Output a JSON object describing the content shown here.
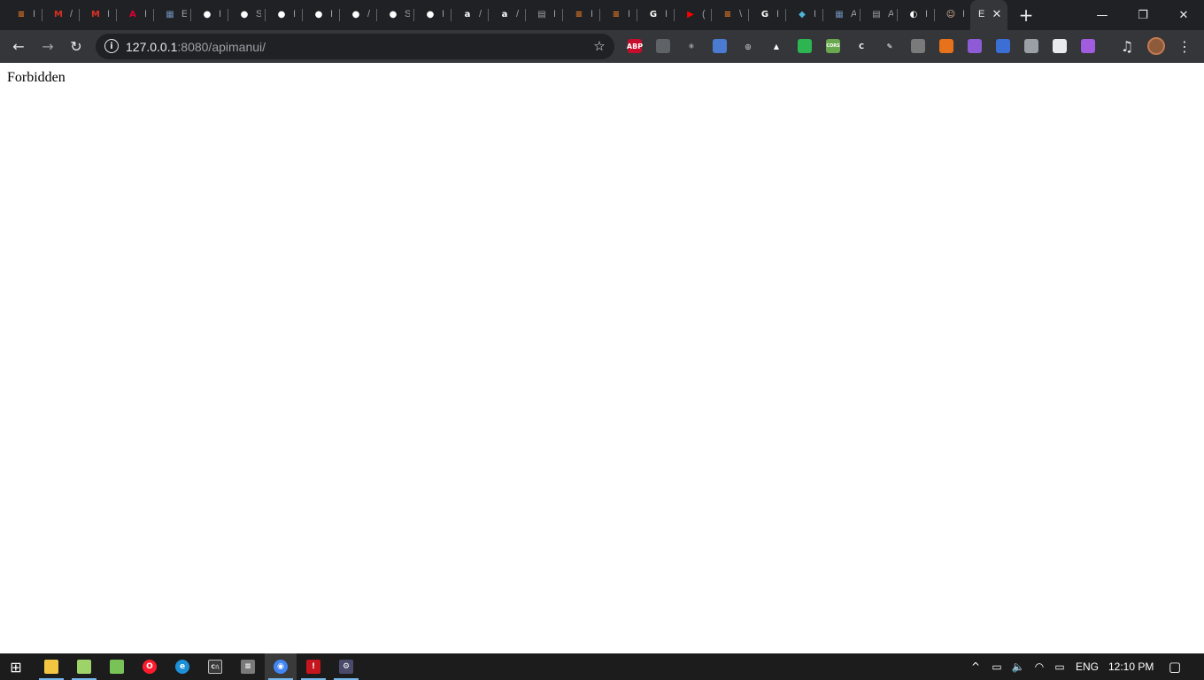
{
  "browser": {
    "tabs": [
      {
        "icon": "stackoverflow-icon",
        "title": "I",
        "color": "#f48024",
        "glyph": "≡"
      },
      {
        "icon": "gmail-icon",
        "title": "/",
        "color": "#d93025",
        "glyph": "M"
      },
      {
        "icon": "gmail-icon",
        "title": "I",
        "color": "#d93025",
        "glyph": "M"
      },
      {
        "icon": "angular-icon",
        "title": "I",
        "color": "#dd0031",
        "glyph": "A"
      },
      {
        "icon": "image-doc-icon",
        "title": "E",
        "color": "#6b8db5",
        "glyph": "▦"
      },
      {
        "icon": "github-icon",
        "title": "I",
        "color": "#ffffff",
        "glyph": "●"
      },
      {
        "icon": "github-icon",
        "title": "S",
        "color": "#ffffff",
        "glyph": "●"
      },
      {
        "icon": "github-icon",
        "title": "I",
        "color": "#ffffff",
        "glyph": "●"
      },
      {
        "icon": "github-icon",
        "title": "I",
        "color": "#ffffff",
        "glyph": "●"
      },
      {
        "icon": "github-icon",
        "title": "/",
        "color": "#ffffff",
        "glyph": "●"
      },
      {
        "icon": "github-icon",
        "title": "S",
        "color": "#ffffff",
        "glyph": "●"
      },
      {
        "icon": "github-icon",
        "title": "I",
        "color": "#ffffff",
        "glyph": "●"
      },
      {
        "icon": "amazon-icon",
        "title": "/",
        "color": "#ffffff",
        "glyph": "a"
      },
      {
        "icon": "amazon-icon",
        "title": "/",
        "color": "#ffffff",
        "glyph": "a"
      },
      {
        "icon": "document-icon",
        "title": "I",
        "color": "#9aa0a6",
        "glyph": "▤"
      },
      {
        "icon": "stackoverflow-icon",
        "title": "I",
        "color": "#f48024",
        "glyph": "≡"
      },
      {
        "icon": "stackoverflow-icon",
        "title": "I",
        "color": "#f48024",
        "glyph": "≡"
      },
      {
        "icon": "google-icon",
        "title": "I",
        "color": "#ffffff",
        "glyph": "G"
      },
      {
        "icon": "youtube-icon",
        "title": "(",
        "color": "#ff0000",
        "glyph": "▶"
      },
      {
        "icon": "stackoverflow-icon",
        "title": "\\",
        "color": "#f48024",
        "glyph": "≡"
      },
      {
        "icon": "google-icon",
        "title": "I",
        "color": "#ffffff",
        "glyph": "G"
      },
      {
        "icon": "cube-icon",
        "title": "I",
        "color": "#4fb3d9",
        "glyph": "◆"
      },
      {
        "icon": "image-doc-icon",
        "title": "A",
        "color": "#6b8db5",
        "glyph": "▦"
      },
      {
        "icon": "document-icon",
        "title": "A",
        "color": "#9aa0a6",
        "glyph": "▤"
      },
      {
        "icon": "globe-icon",
        "title": "I",
        "color": "#ffffff",
        "glyph": "◐"
      },
      {
        "icon": "avatar-icon",
        "title": "I",
        "color": "#e0b896",
        "glyph": "☺"
      }
    ],
    "active_tab": {
      "title": "E",
      "close_glyph": "✕"
    },
    "new_tab_glyph": "+",
    "window_controls": {
      "minimize": "—",
      "restore": "❐",
      "close": "✕"
    },
    "nav": {
      "back": "←",
      "forward": "→",
      "reload": "↻"
    },
    "address": {
      "info_glyph": "i",
      "host": "127.0.0.1",
      "rest": ":8080/apimanui/",
      "star_glyph": "☆"
    },
    "extensions": [
      {
        "icon": "adblock-plus-icon",
        "label": "ABP",
        "color": "#c70d2c"
      },
      {
        "icon": "lightbulb-icon",
        "label": "",
        "color": "#5f6368"
      },
      {
        "icon": "react-devtools-icon",
        "label": "⚛",
        "color": "#35363a"
      },
      {
        "icon": "circle-ext-icon",
        "label": "",
        "color": "#4a7bd0"
      },
      {
        "icon": "target-icon",
        "label": "◎",
        "color": "#35363a"
      },
      {
        "icon": "drive-icon",
        "label": "▲",
        "color": "#35363a"
      },
      {
        "icon": "green-square-icon",
        "label": "",
        "color": "#2db552"
      },
      {
        "icon": "cors-icon",
        "label": "CORS",
        "color": "#6aa84f"
      },
      {
        "icon": "c-circle-icon",
        "label": "C",
        "color": "#35363a"
      },
      {
        "icon": "pen-icon",
        "label": "✎",
        "color": "#35363a"
      },
      {
        "icon": "window-ext-icon",
        "label": "",
        "color": "#7a7a7a"
      },
      {
        "icon": "orange-ext-icon",
        "label": "",
        "color": "#e8711c"
      },
      {
        "icon": "feather-icon",
        "label": "",
        "color": "#8e5bd6"
      },
      {
        "icon": "blue-square-icon",
        "label": "",
        "color": "#3b6fd6"
      },
      {
        "icon": "cloud-ext-icon",
        "label": "",
        "color": "#9aa0a6"
      },
      {
        "icon": "printer-ext-icon",
        "label": "",
        "color": "#e8eaed"
      },
      {
        "icon": "purple-ext-icon",
        "label": "",
        "color": "#a15ce0"
      }
    ],
    "media_glyph": "♫",
    "menu_glyph": "⋮"
  },
  "page": {
    "message": "Forbidden"
  },
  "taskbar": {
    "start_glyph": "⊞",
    "apps": [
      {
        "icon": "file-explorer-icon",
        "color": "#f2c641",
        "glyph": "",
        "running": true,
        "focused": false
      },
      {
        "icon": "notepad-icon",
        "color": "#9ed36a",
        "glyph": "",
        "running": true,
        "focused": false
      },
      {
        "icon": "android-studio-icon",
        "color": "#78c257",
        "glyph": "",
        "running": false,
        "focused": false
      },
      {
        "icon": "opera-icon",
        "color": "#ff1b2d",
        "glyph": "O",
        "running": false,
        "focused": false
      },
      {
        "icon": "edge-icon",
        "color": "#1e90d8",
        "glyph": "e",
        "running": false,
        "focused": false
      },
      {
        "icon": "command-prompt-icon",
        "color": "#3a3a3a",
        "glyph": "C:\\",
        "running": false,
        "focused": false
      },
      {
        "icon": "app-gray-icon",
        "color": "#7a7a7a",
        "glyph": "≡",
        "running": false,
        "focused": false
      },
      {
        "icon": "chrome-icon",
        "color": "#4285f4",
        "glyph": "◉",
        "running": true,
        "focused": true
      },
      {
        "icon": "imovie-red-icon",
        "color": "#c4161c",
        "glyph": "!",
        "running": true,
        "focused": false
      },
      {
        "icon": "settings-app-icon",
        "color": "#4a4a6a",
        "glyph": "⚙",
        "running": true,
        "focused": false
      }
    ],
    "tray": {
      "chevron": "^",
      "language": "ENG",
      "time": "12:10 PM",
      "volume_glyph": "🔈",
      "wifi_glyph": "◠",
      "battery_glyph": "▭",
      "notification_glyph": "▢"
    }
  }
}
